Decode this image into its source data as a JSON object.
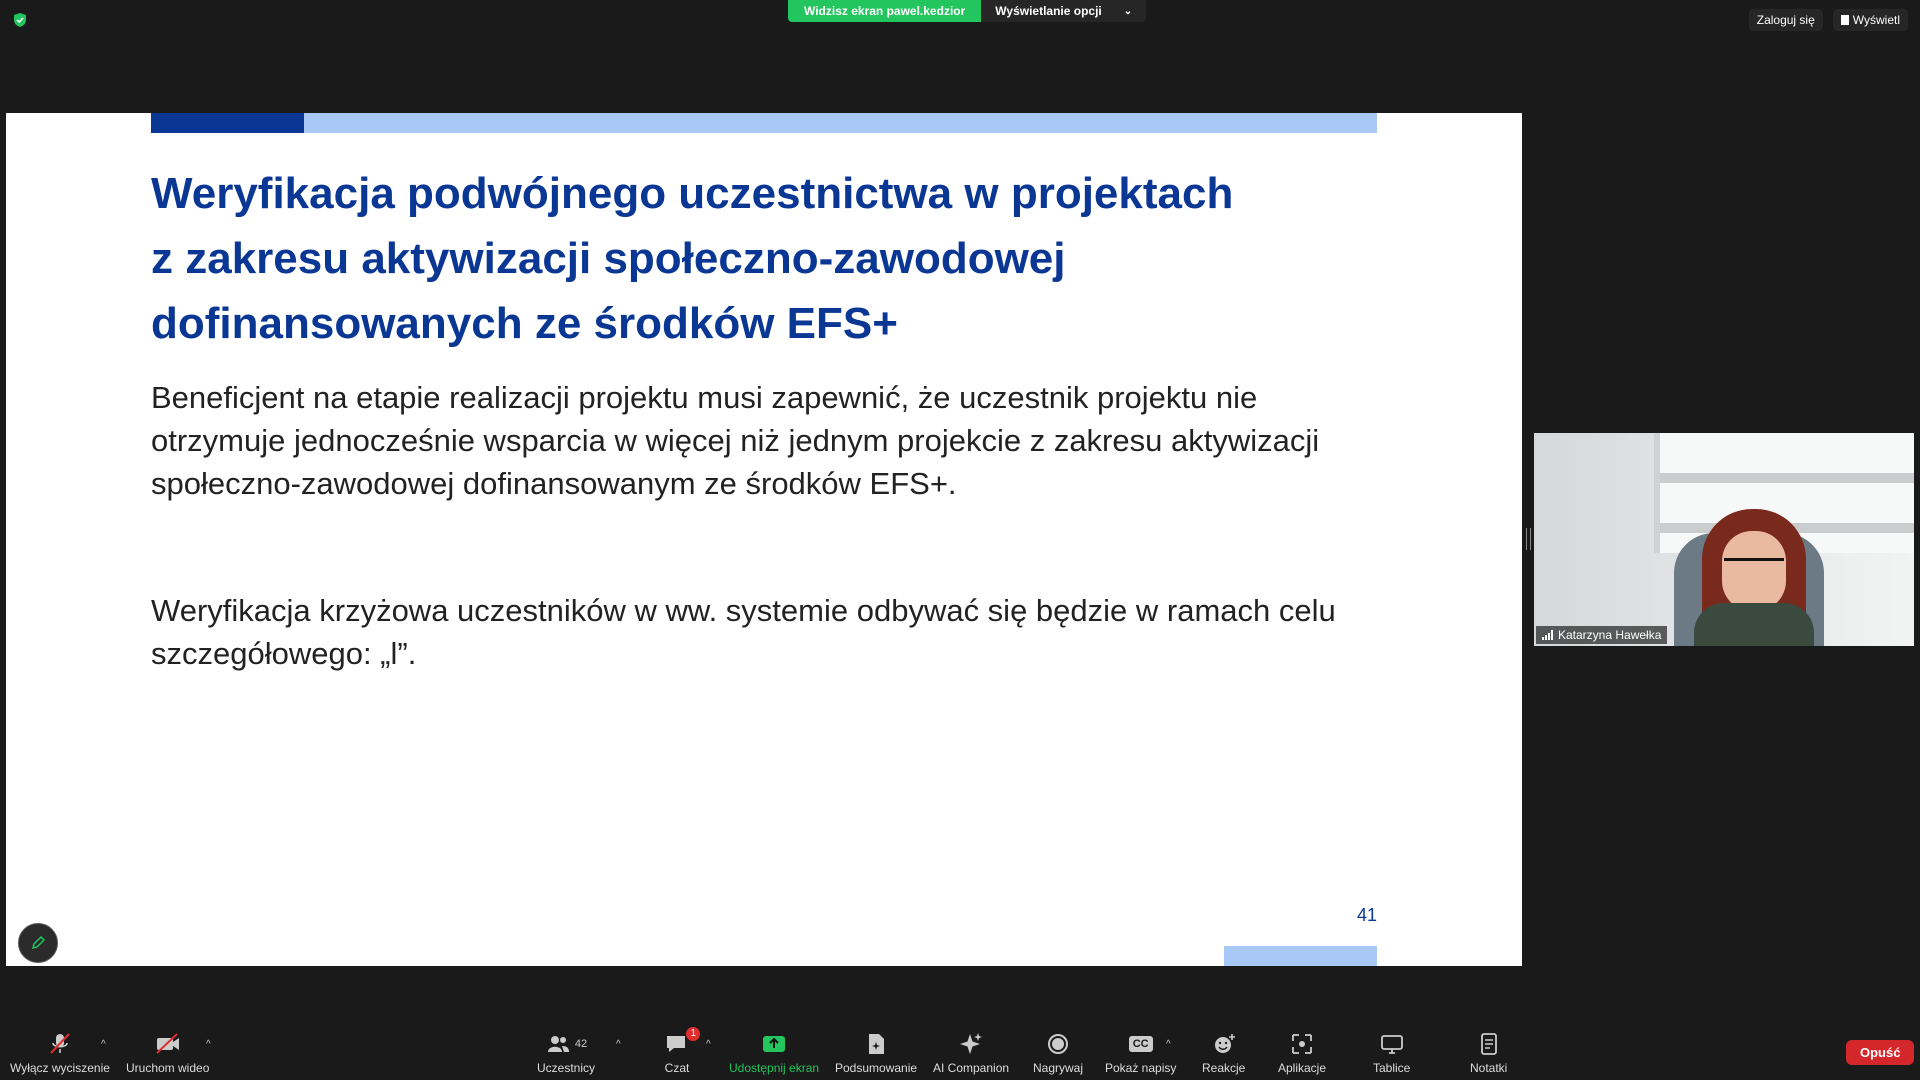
{
  "top_bar": {
    "share_status": "Widzisz ekran pawel.kedzior",
    "view_options": "Wyświetlanie opcji",
    "login_label": "Zaloguj się",
    "view_label": "Wyświetl"
  },
  "slide": {
    "title_lines": [
      "Weryfikacja podwójnego uczestnictwa w projektach",
      "z zakresu aktywizacji społeczno-zawodowej",
      "dofinansowanych ze środków EFS+"
    ],
    "paragraph1_lines": [
      "Beneficjent na etapie realizacji projektu  musi zapewnić, że uczestnik projektu nie",
      "otrzymuje jednocześnie wsparcia w więcej niż jednym projekcie z zakresu aktywizacji",
      "społeczno-zawodowej dofinansowanym ze środków EFS+."
    ],
    "paragraph2_lines": [
      "Weryfikacja krzyżowa uczestników w ww. systemie odbywać się będzie w ramach celu",
      "szczegółowego: „l”."
    ],
    "page_number": "41",
    "colors": {
      "accent_dark": "#0a3694",
      "accent_light": "#a8c9f7"
    }
  },
  "participant": {
    "name": "Katarzyna Hawełka"
  },
  "toolbar": {
    "mute_label": "Wyłącz wyciszenie",
    "video_label": "Uruchom wideo",
    "participants_label": "Uczestnicy",
    "participants_count": "42",
    "chat_label": "Czat",
    "chat_badge": "1",
    "share_label": "Udostępnij ekran",
    "summary_label": "Podsumowanie",
    "ai_label": "AI Companion",
    "record_label": "Nagrywaj",
    "captions_label": "Pokaż napisy",
    "captions_icon_text": "CC",
    "reactions_label": "Reakcje",
    "apps_label": "Aplikacje",
    "whiteboards_label": "Tablice",
    "notes_label": "Notatki",
    "leave_label": "Opuść"
  }
}
